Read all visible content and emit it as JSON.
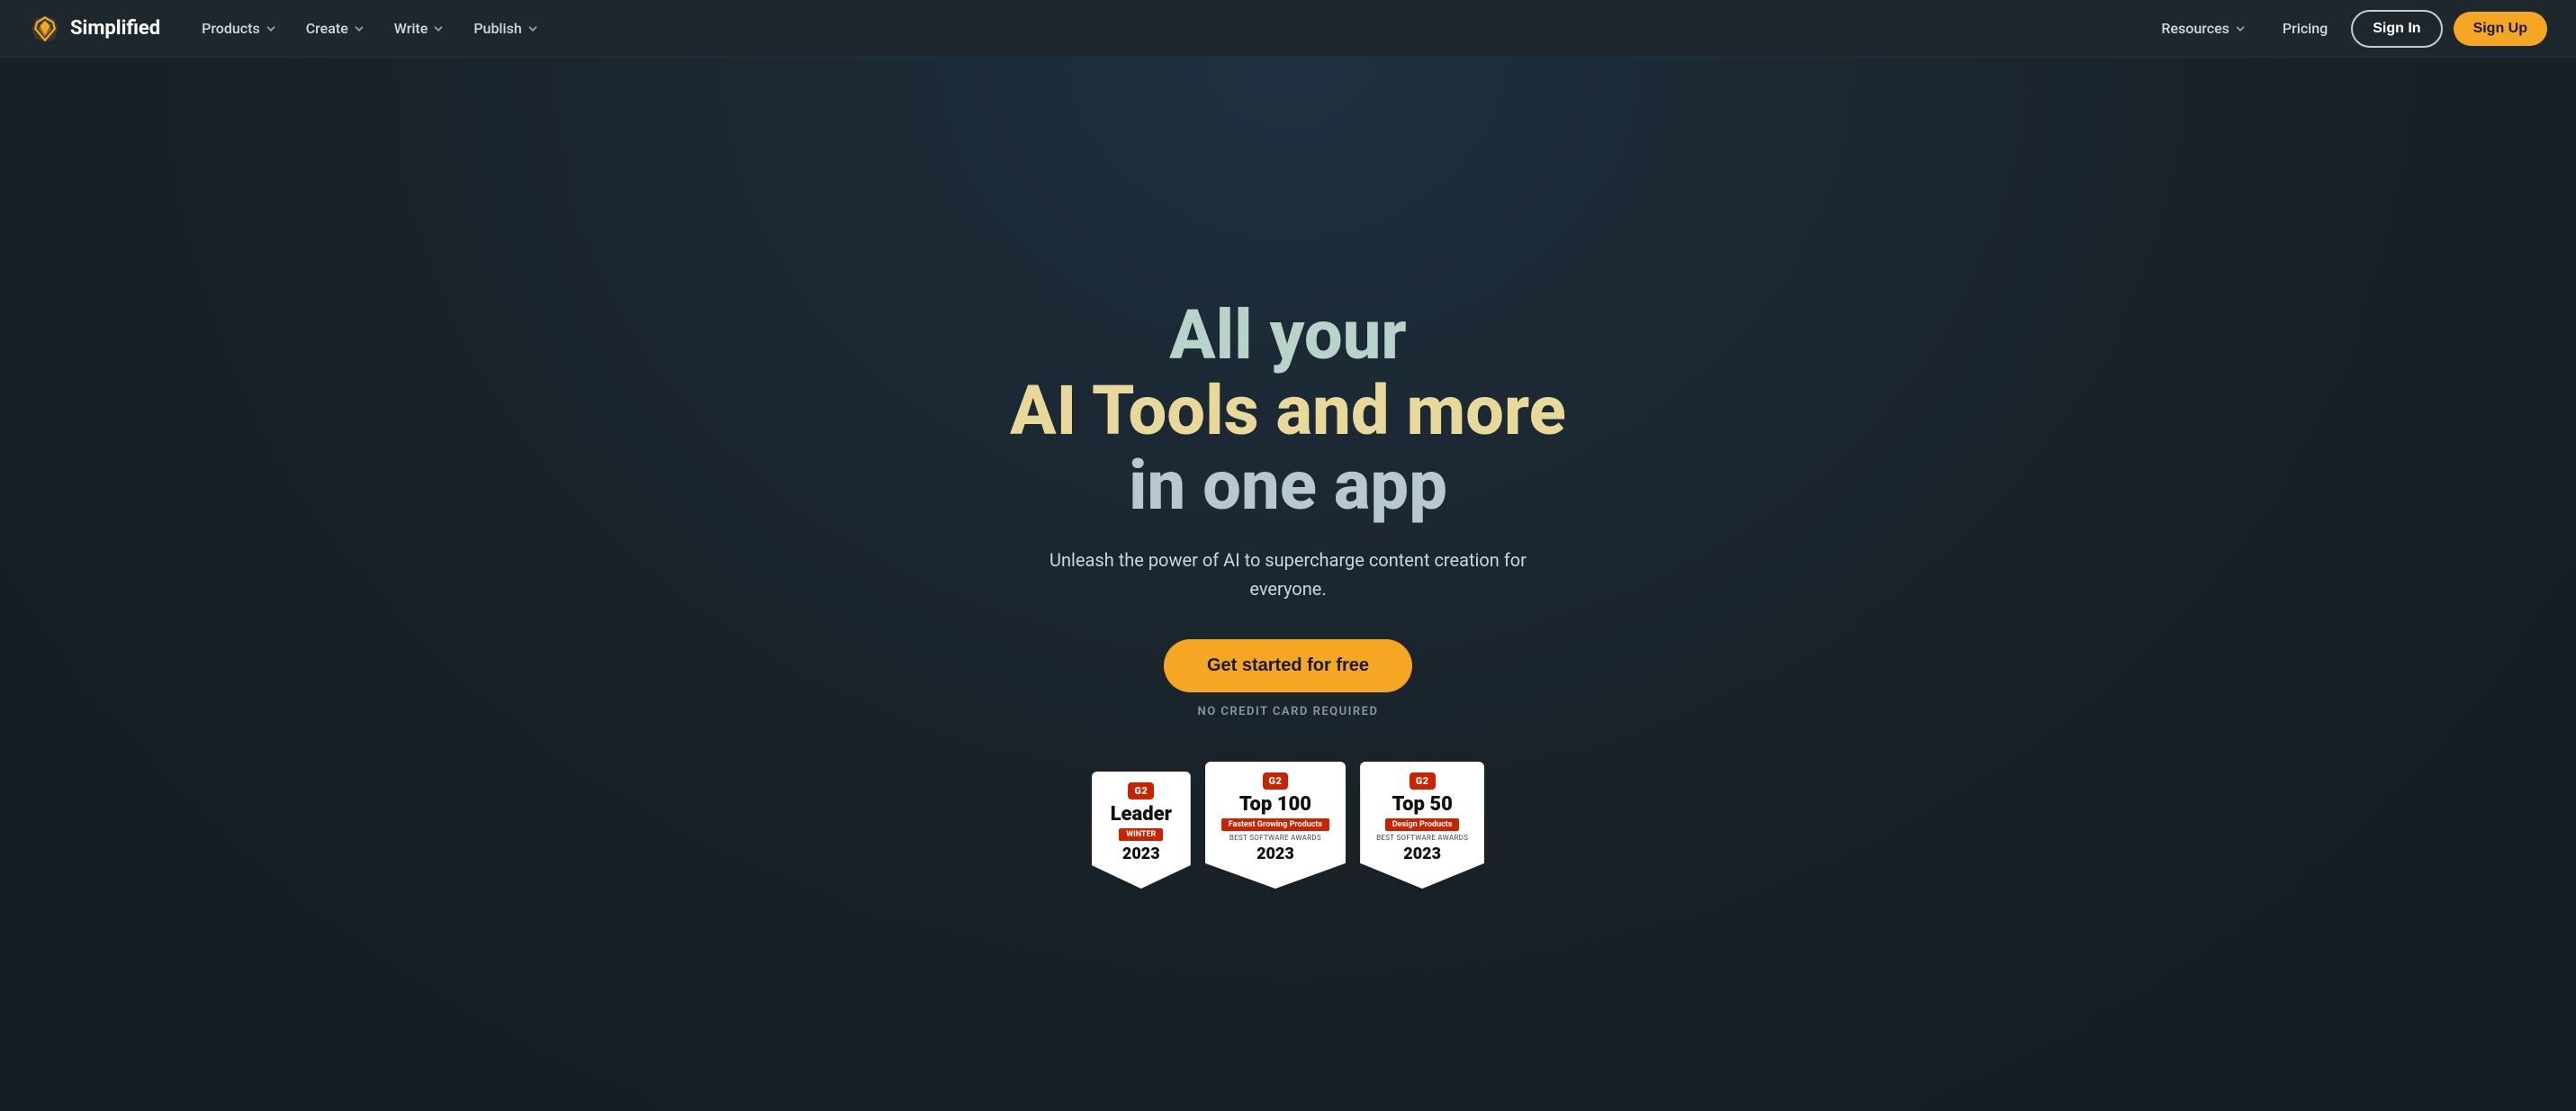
{
  "brand": {
    "name": "Simplified",
    "logo_alt": "Simplified Logo"
  },
  "nav": {
    "items": [
      {
        "label": "Products",
        "has_dropdown": true
      },
      {
        "label": "Create",
        "has_dropdown": true
      },
      {
        "label": "Write",
        "has_dropdown": true
      },
      {
        "label": "Publish",
        "has_dropdown": true
      },
      {
        "label": "Resources",
        "has_dropdown": true
      },
      {
        "label": "Pricing",
        "has_dropdown": false
      }
    ],
    "signin_label": "Sign In",
    "signup_label": "Sign Up"
  },
  "hero": {
    "title_line1": "All your",
    "title_line2": "AI Tools and more",
    "title_line3": "in one app",
    "subtitle": "Unleash the power of AI to supercharge content creation for everyone.",
    "cta_label": "Get started for free",
    "no_credit_label": "NO CREDIT CARD REQUIRED"
  },
  "badges": [
    {
      "g2_label": "G2",
      "main_label": "Leader",
      "sub_label": "WINTER",
      "detail": "",
      "year": "2023"
    },
    {
      "g2_label": "G2",
      "main_label": "Top 100",
      "sub_label": "Fastest Growing Products",
      "detail": "BEST SOFTWARE AWARDS",
      "year": "2023"
    },
    {
      "g2_label": "G2",
      "main_label": "Top 50",
      "sub_label": "Design Products",
      "detail": "BEST SOFTWARE AWARDS",
      "year": "2023"
    }
  ]
}
